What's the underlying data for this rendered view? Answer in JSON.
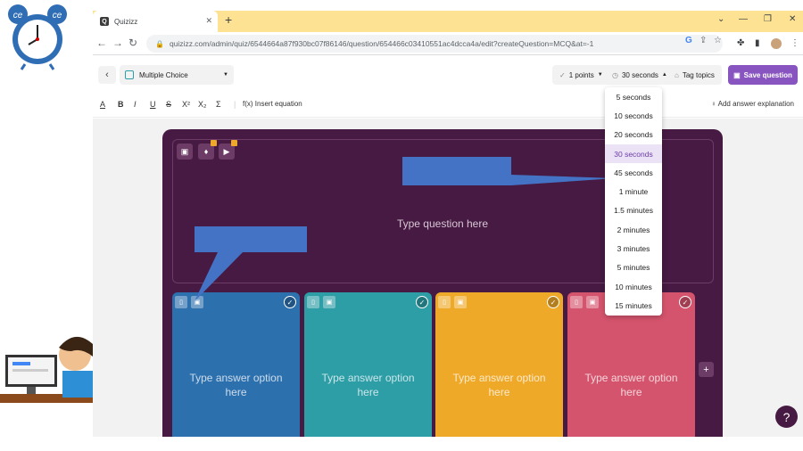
{
  "browser": {
    "tab_title": "Quizizz",
    "tab_favicon": "Q",
    "url": "quizizz.com/admin/quiz/6544664a87f930bc07f86146/question/654466c03410551ac4dcca4a/edit?createQuestion=MCQ&at=-1"
  },
  "toolbar": {
    "question_type": "Multiple Choice",
    "points": "1 points",
    "time": "30 seconds",
    "tag_topics": "Tag topics",
    "save": "Save question"
  },
  "format_bar": {
    "insert_equation": "Insert equation",
    "add_explanation": "Add answer explanation"
  },
  "question": {
    "placeholder": "Type question here"
  },
  "options": [
    {
      "placeholder": "Type answer option here",
      "color": "#2d70ae"
    },
    {
      "placeholder": "Type answer option here",
      "color": "#2d9da6"
    },
    {
      "placeholder": "Type answer option here",
      "color": "#efa929"
    },
    {
      "placeholder": "Type answer option here",
      "color": "#d5546d"
    }
  ],
  "time_dropdown": {
    "items": [
      "5 seconds",
      "10 seconds",
      "20 seconds",
      "30 seconds",
      "45 seconds",
      "1 minute",
      "1.5 minutes",
      "2 minutes",
      "3 minutes",
      "5 minutes",
      "10 minutes",
      "15 minutes"
    ],
    "selected": "30 seconds"
  },
  "colors": {
    "brand": "#8854c0",
    "card": "#461a42",
    "callout": "#4472c4",
    "tabbar": "#fde293"
  }
}
